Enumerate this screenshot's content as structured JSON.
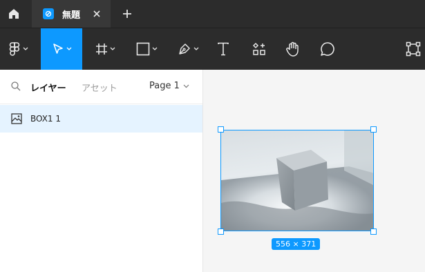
{
  "tabbar": {
    "home_icon": "home-icon",
    "tab_title": "無題",
    "close_icon": "close-icon",
    "new_tab_icon": "plus-icon"
  },
  "toolbar": {
    "tools": [
      "figma-menu",
      "move-tool",
      "frame-tool",
      "shape-tool",
      "pen-tool",
      "text-tool",
      "resources-tool",
      "hand-tool",
      "comment-tool",
      "dev-mode-toggle"
    ],
    "active_tool": "move-tool",
    "accent_color": "#0d99ff"
  },
  "leftpanel": {
    "tab_layers": "レイヤー",
    "tab_assets": "アセット",
    "page_label": "Page 1",
    "layers": [
      {
        "name": "BOX1 1"
      }
    ]
  },
  "canvas": {
    "dimensions": "556 × 371"
  }
}
